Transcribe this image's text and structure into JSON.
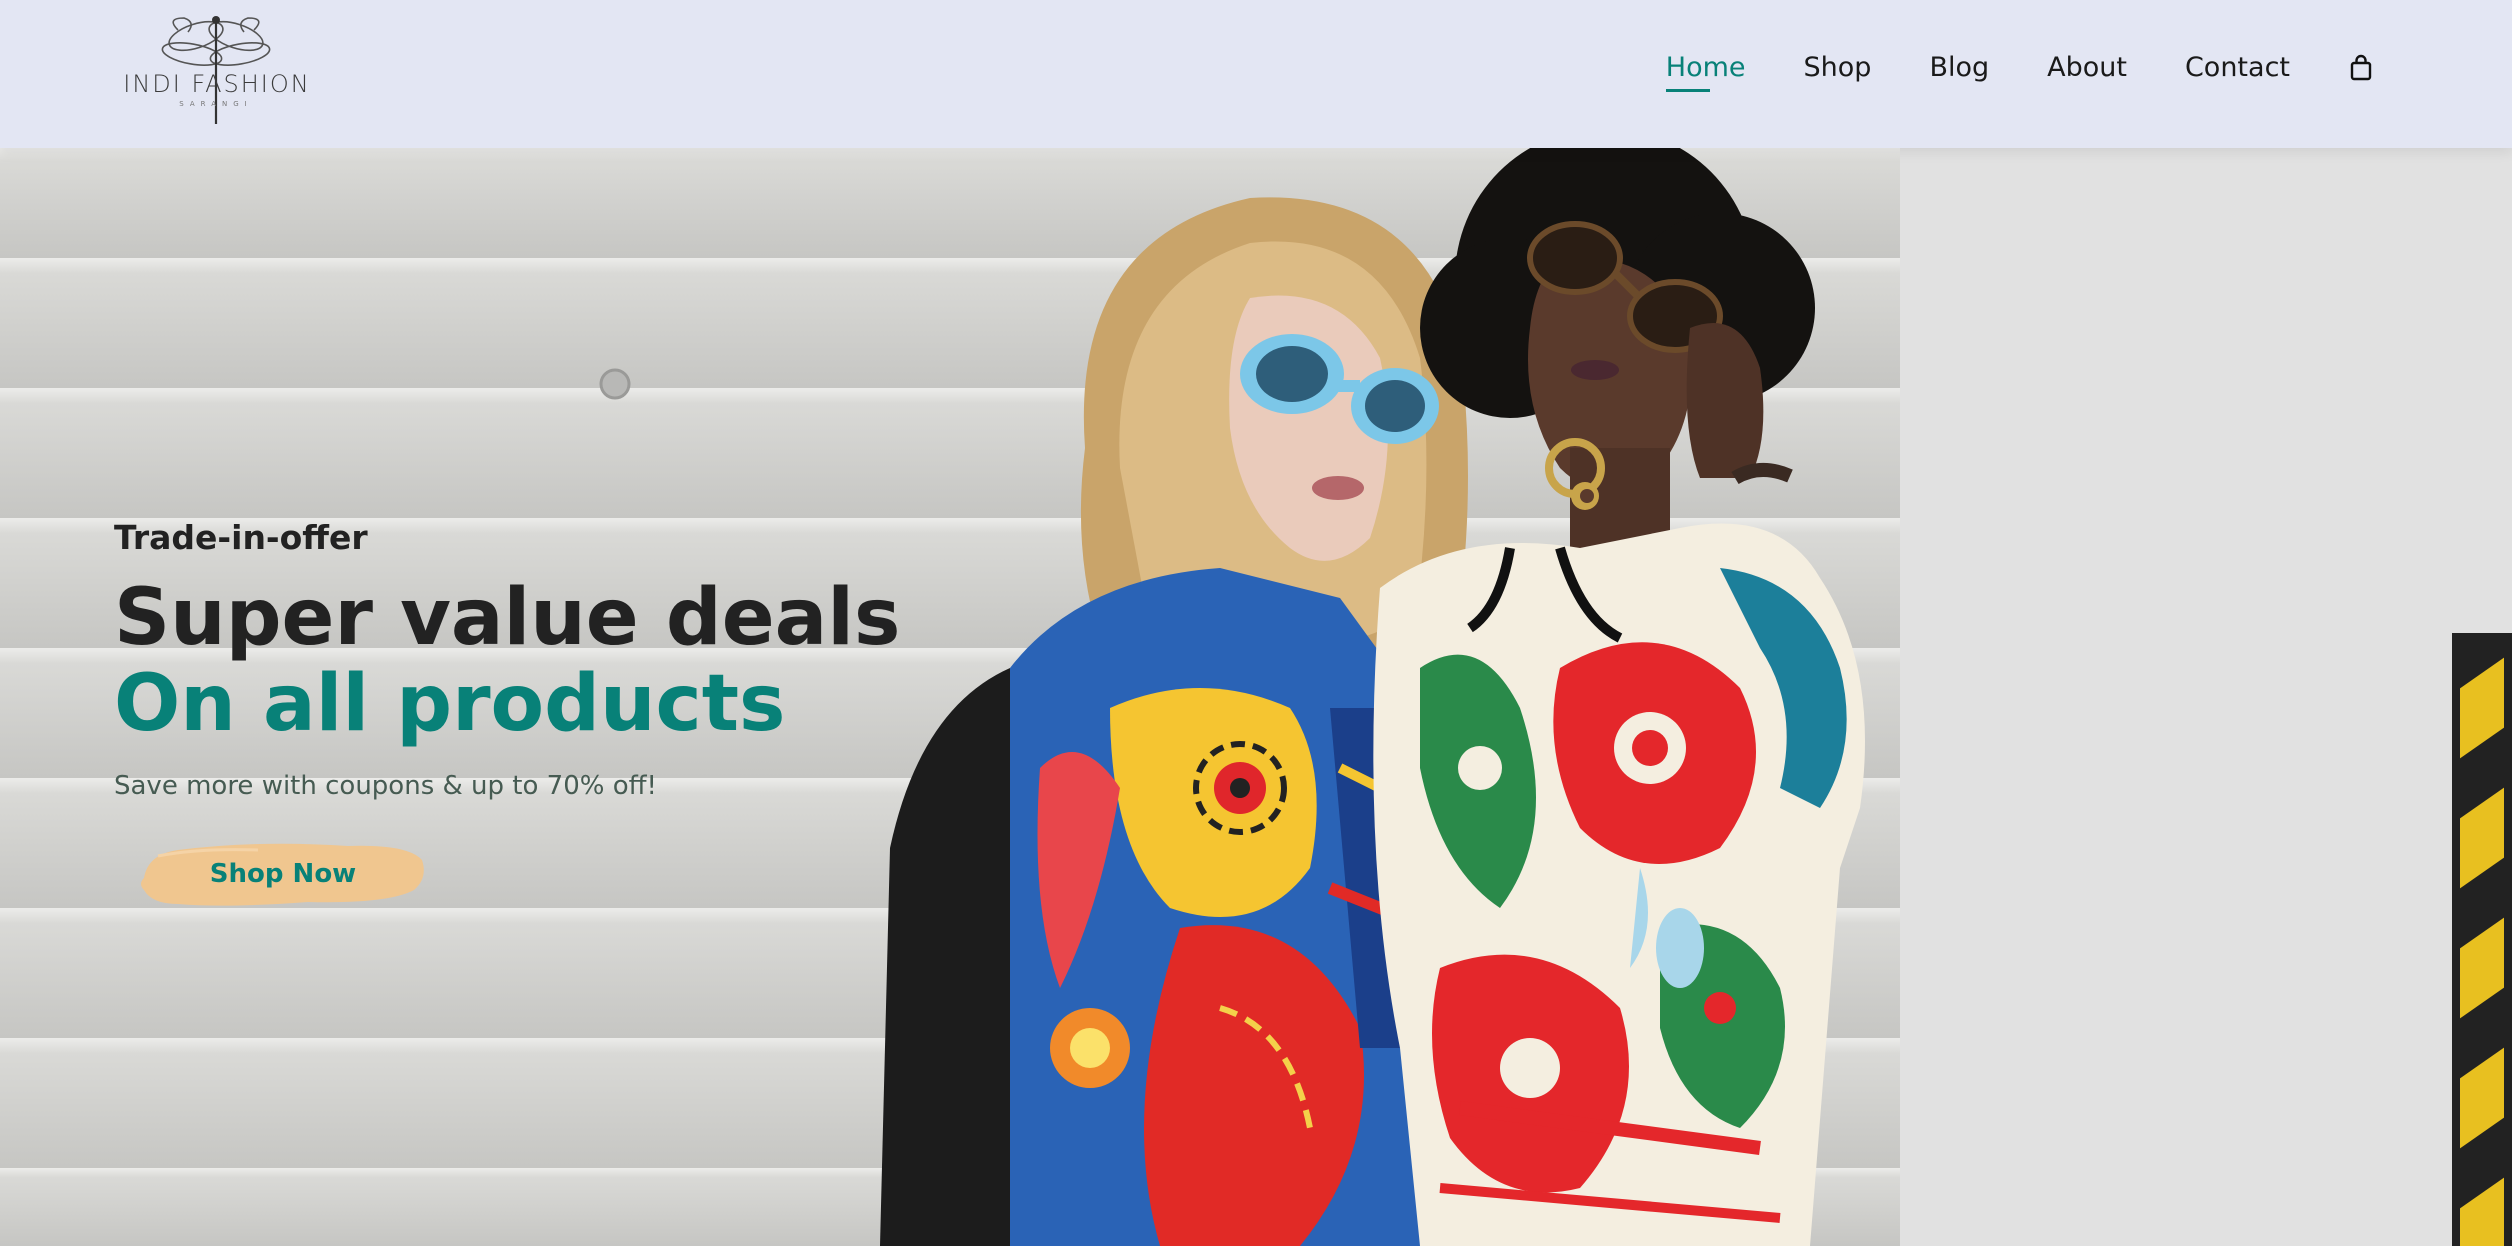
{
  "brand": {
    "logo_text": "INDI FASHION",
    "logo_subtext": "SARANGI"
  },
  "nav": {
    "items": [
      {
        "label": "Home",
        "active": true
      },
      {
        "label": "Shop",
        "active": false
      },
      {
        "label": "Blog",
        "active": false
      },
      {
        "label": "About",
        "active": false
      },
      {
        "label": "Contact",
        "active": false
      }
    ],
    "cart_icon": "shopping-bag-icon"
  },
  "hero": {
    "subtitle": "Trade-in-offer",
    "headline_line1": "Super value deals",
    "headline_line2": "On all products",
    "description": "Save more with coupons & up to 70% off!",
    "button_label": "Shop Now"
  },
  "colors": {
    "accent": "#088178",
    "header_bg": "#e3e6f3",
    "button_brush": "#f0c68f",
    "text_dark": "#222222"
  }
}
